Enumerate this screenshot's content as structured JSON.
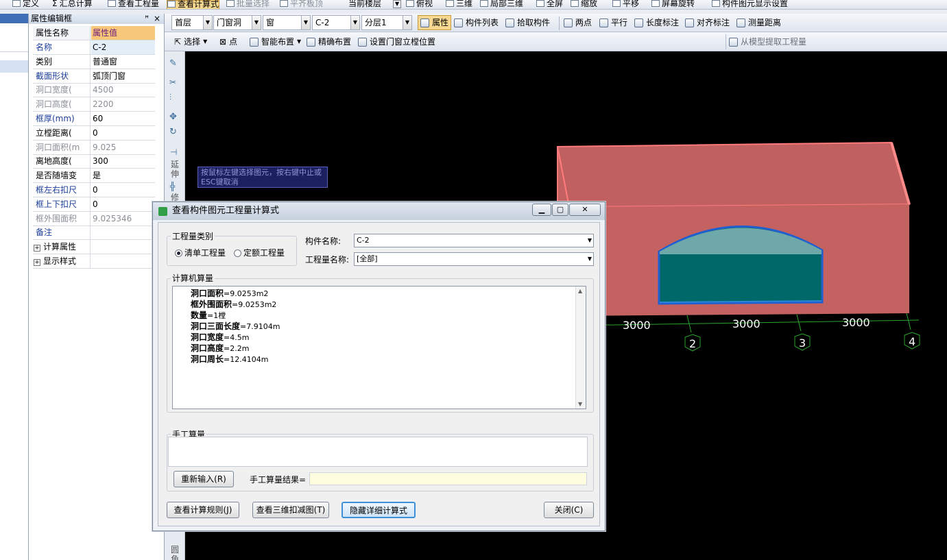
{
  "top_toolbar": {
    "items": [
      "定义",
      "汇总计算",
      "查看工程量",
      "查看计算式",
      "批量选择",
      "平齐板顶",
      "当前楼层",
      "俯视",
      "三维",
      "局部三维",
      "全屏",
      "缩放",
      "平移",
      "屏幕旋转",
      "构件图元显示设置"
    ]
  },
  "second_toolbar": {
    "floor": "首层",
    "category": "门窗洞",
    "type": "窗",
    "component": "C-2",
    "layer": "分层1",
    "buttons": [
      "属性",
      "构件列表",
      "拾取构件",
      "两点",
      "平行",
      "长度标注",
      "对齐标注",
      "测量距离"
    ]
  },
  "third_toolbar": {
    "buttons": [
      "选择",
      "点",
      "智能布置",
      "精确布置",
      "设置门窗立樘位置"
    ],
    "right_button": "从模型提取工程量"
  },
  "property_panel": {
    "title": "属性编辑框",
    "header_key": "属性名称",
    "header_value": "属性值",
    "rows": [
      {
        "k": "名称",
        "v": "C-2"
      },
      {
        "k": "类别",
        "v": "普通窗"
      },
      {
        "k": "截面形状",
        "v": "弧顶门窗"
      },
      {
        "k": "洞口宽度(",
        "v": "4500"
      },
      {
        "k": "洞口高度(",
        "v": "2200"
      },
      {
        "k": "框厚(mm)",
        "v": "60"
      },
      {
        "k": "立樘距离(",
        "v": "0"
      },
      {
        "k": "洞口面积(m",
        "v": "9.025"
      },
      {
        "k": "离地高度(",
        "v": "300"
      },
      {
        "k": "是否随墙变",
        "v": "是"
      },
      {
        "k": "框左右扣尺",
        "v": "0"
      },
      {
        "k": "框上下扣尺",
        "v": "0"
      },
      {
        "k": "框外围面积",
        "v": "9.025346"
      },
      {
        "k": "备注",
        "v": ""
      },
      {
        "k": "计算属性",
        "v": ""
      },
      {
        "k": "显示样式",
        "v": ""
      }
    ]
  },
  "vertical_tools": {
    "extend": "延伸",
    "modify": "修",
    "round": "圆角"
  },
  "tooltip": "按鼠标左键选择图元，按右键中止或ESC键取消",
  "viewport": {
    "dims": [
      "3000",
      "3000",
      "3000"
    ],
    "axes": [
      "2",
      "3",
      "4"
    ]
  },
  "dialog": {
    "title": "查看构件图元工程量计算式",
    "qty_type_label": "工程量类别",
    "radio_bill": "清单工程量",
    "radio_quota": "定额工程量",
    "component_label": "构件名称:",
    "component_value": "C-2",
    "qty_name_label": "工程量名称:",
    "qty_name_value": "[全部]",
    "calc_label": "计算机算量",
    "calc_lines": [
      {
        "name": "洞口面积",
        "value": "=9.0253m2"
      },
      {
        "name": "框外围面积",
        "value": "=9.0253m2"
      },
      {
        "name": "数量",
        "value": "=1樘"
      },
      {
        "name": "洞口三面长度",
        "value": "=7.9104m"
      },
      {
        "name": "洞口宽度",
        "value": "=4.5m"
      },
      {
        "name": "洞口高度",
        "value": "=2.2m"
      },
      {
        "name": "洞口周长",
        "value": "=12.4104m"
      }
    ],
    "manual_label": "手工算量",
    "reenter_button": "重新输入(R)",
    "manual_result_label": "手工算量结果=",
    "rules_button": "查看计算规则(J)",
    "deduct_button": "查看三维扣减图(T)",
    "hide_button": "隐藏详细计算式",
    "close_button": "关闭(C)"
  }
}
